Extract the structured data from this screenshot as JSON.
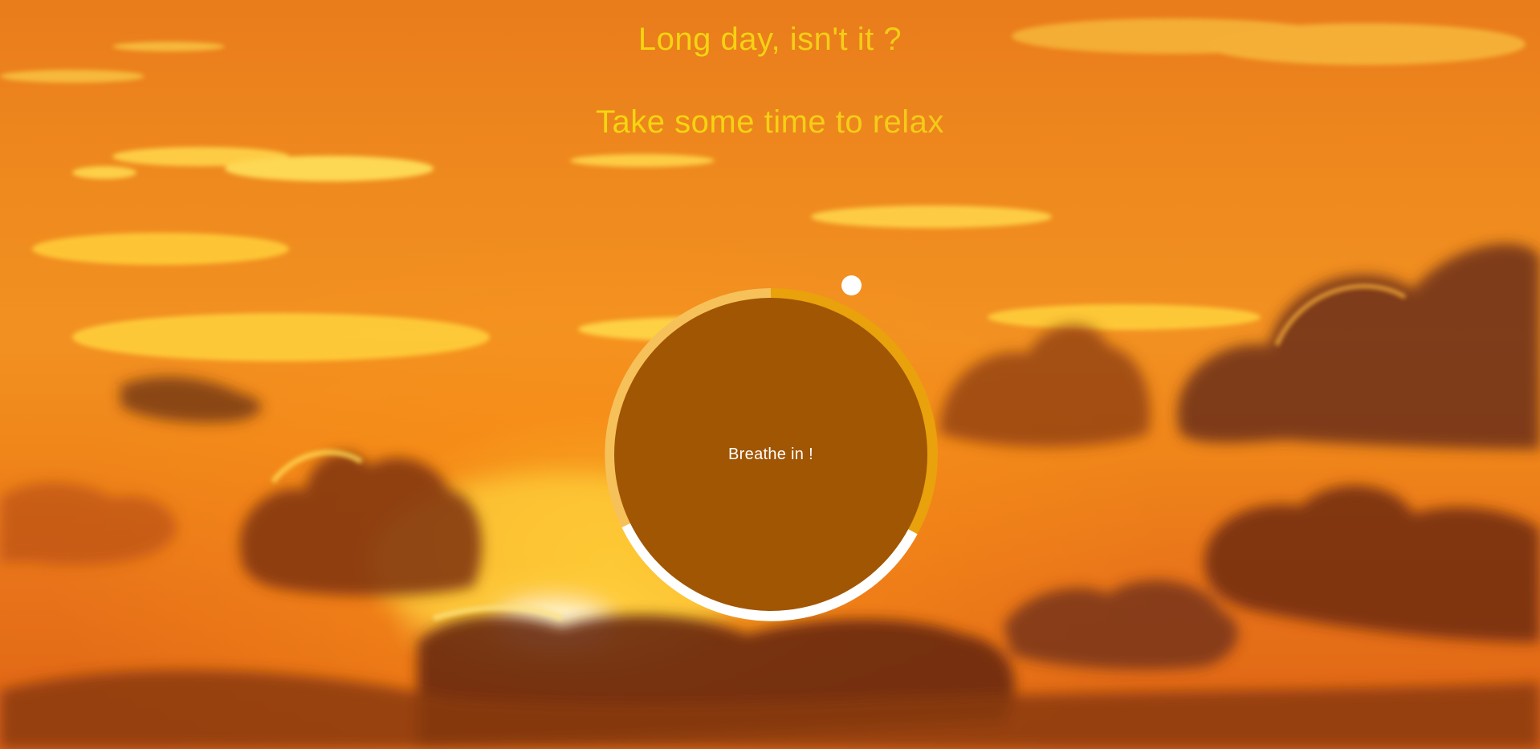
{
  "heading": {
    "line1": "Long day, isn't it ?",
    "line2": "Take some time to relax"
  },
  "breathing": {
    "instruction": "Breathe in !",
    "progress_fraction": 0.12
  },
  "colors": {
    "circle_fill": "#a15604",
    "ring_in": "#f7c15a",
    "ring_hold": "#e9a10c",
    "ring_out": "#ffffff",
    "heading_text": "#f5d411"
  }
}
